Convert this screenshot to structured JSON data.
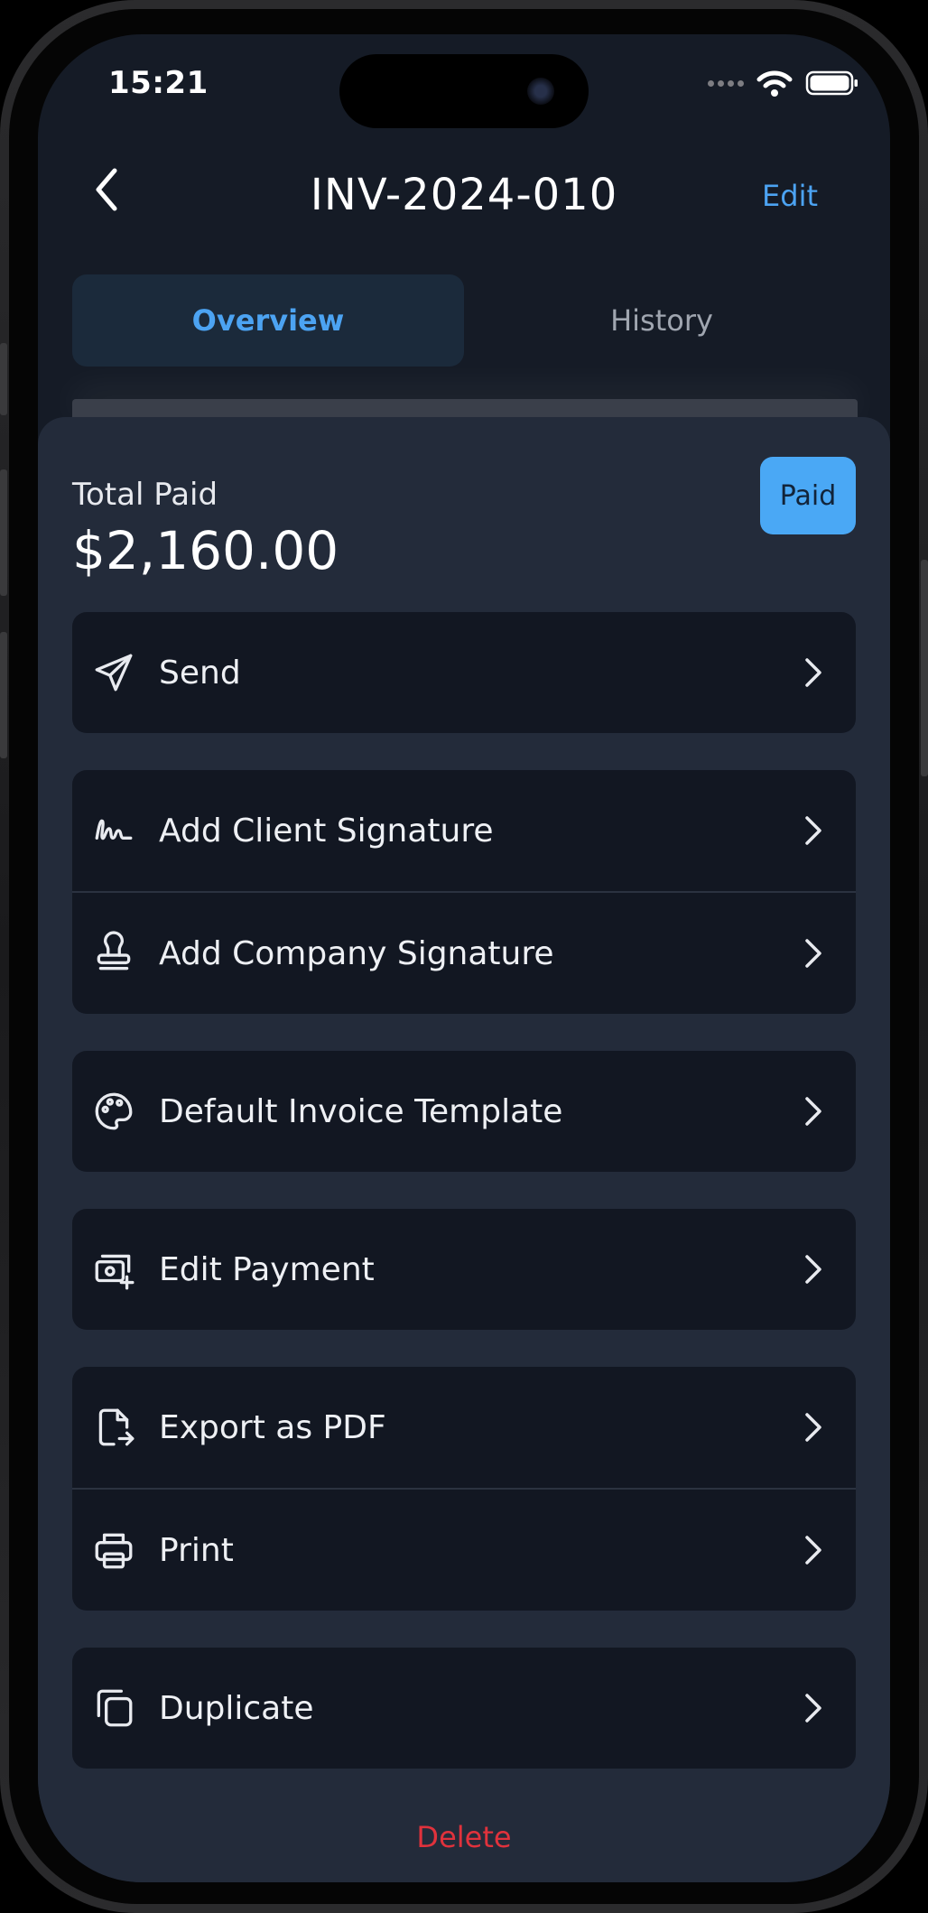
{
  "status_bar": {
    "time": "15:21"
  },
  "nav": {
    "title": "INV-2024-010",
    "edit_label": "Edit"
  },
  "tabs": [
    {
      "label": "Overview",
      "active": true
    },
    {
      "label": "History",
      "active": false
    }
  ],
  "summary": {
    "total_label": "Total Paid",
    "total_value": "$2,160.00",
    "status_badge": "Paid"
  },
  "actions": {
    "send": "Send",
    "add_client_signature": "Add Client Signature",
    "add_company_signature": "Add Company Signature",
    "default_invoice_template": "Default Invoice Template",
    "edit_payment": "Edit Payment",
    "export_pdf": "Export as PDF",
    "print": "Print",
    "duplicate": "Duplicate"
  },
  "delete_label": "Delete",
  "colors": {
    "accent": "#4ca3f2",
    "badge_bg": "#4aa8f5",
    "danger": "#e0323c",
    "sheet_bg": "#232b3a",
    "card_bg": "#121722",
    "screen_bg": "#151b26"
  }
}
